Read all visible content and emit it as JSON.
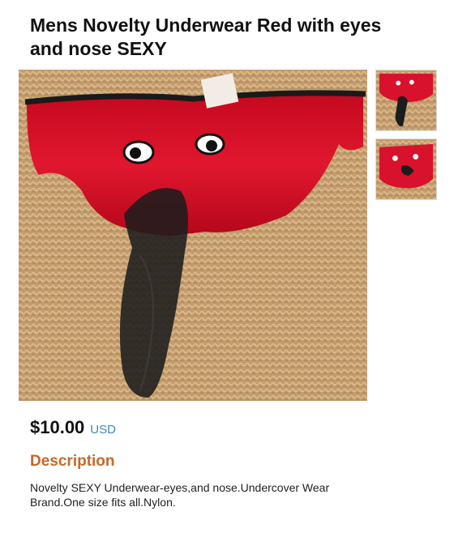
{
  "product": {
    "title": "Mens Novelty Underwear Red with eyes and nose SEXY",
    "price": "$10.00",
    "currency": "USD"
  },
  "gallery": {
    "main_image": "product-photo",
    "thumbnails": [
      "thumbnail-1",
      "thumbnail-2"
    ]
  },
  "description": {
    "heading": "Description",
    "text": "Novelty SEXY Underwear-eyes,and nose.Undercover Wear Brand.One size fits all.Nylon."
  },
  "colors": {
    "heading_accent": "#c8672a",
    "currency_link": "#3a86c8",
    "product_red": "#d8122c",
    "background_burlap": "#c6a071"
  }
}
